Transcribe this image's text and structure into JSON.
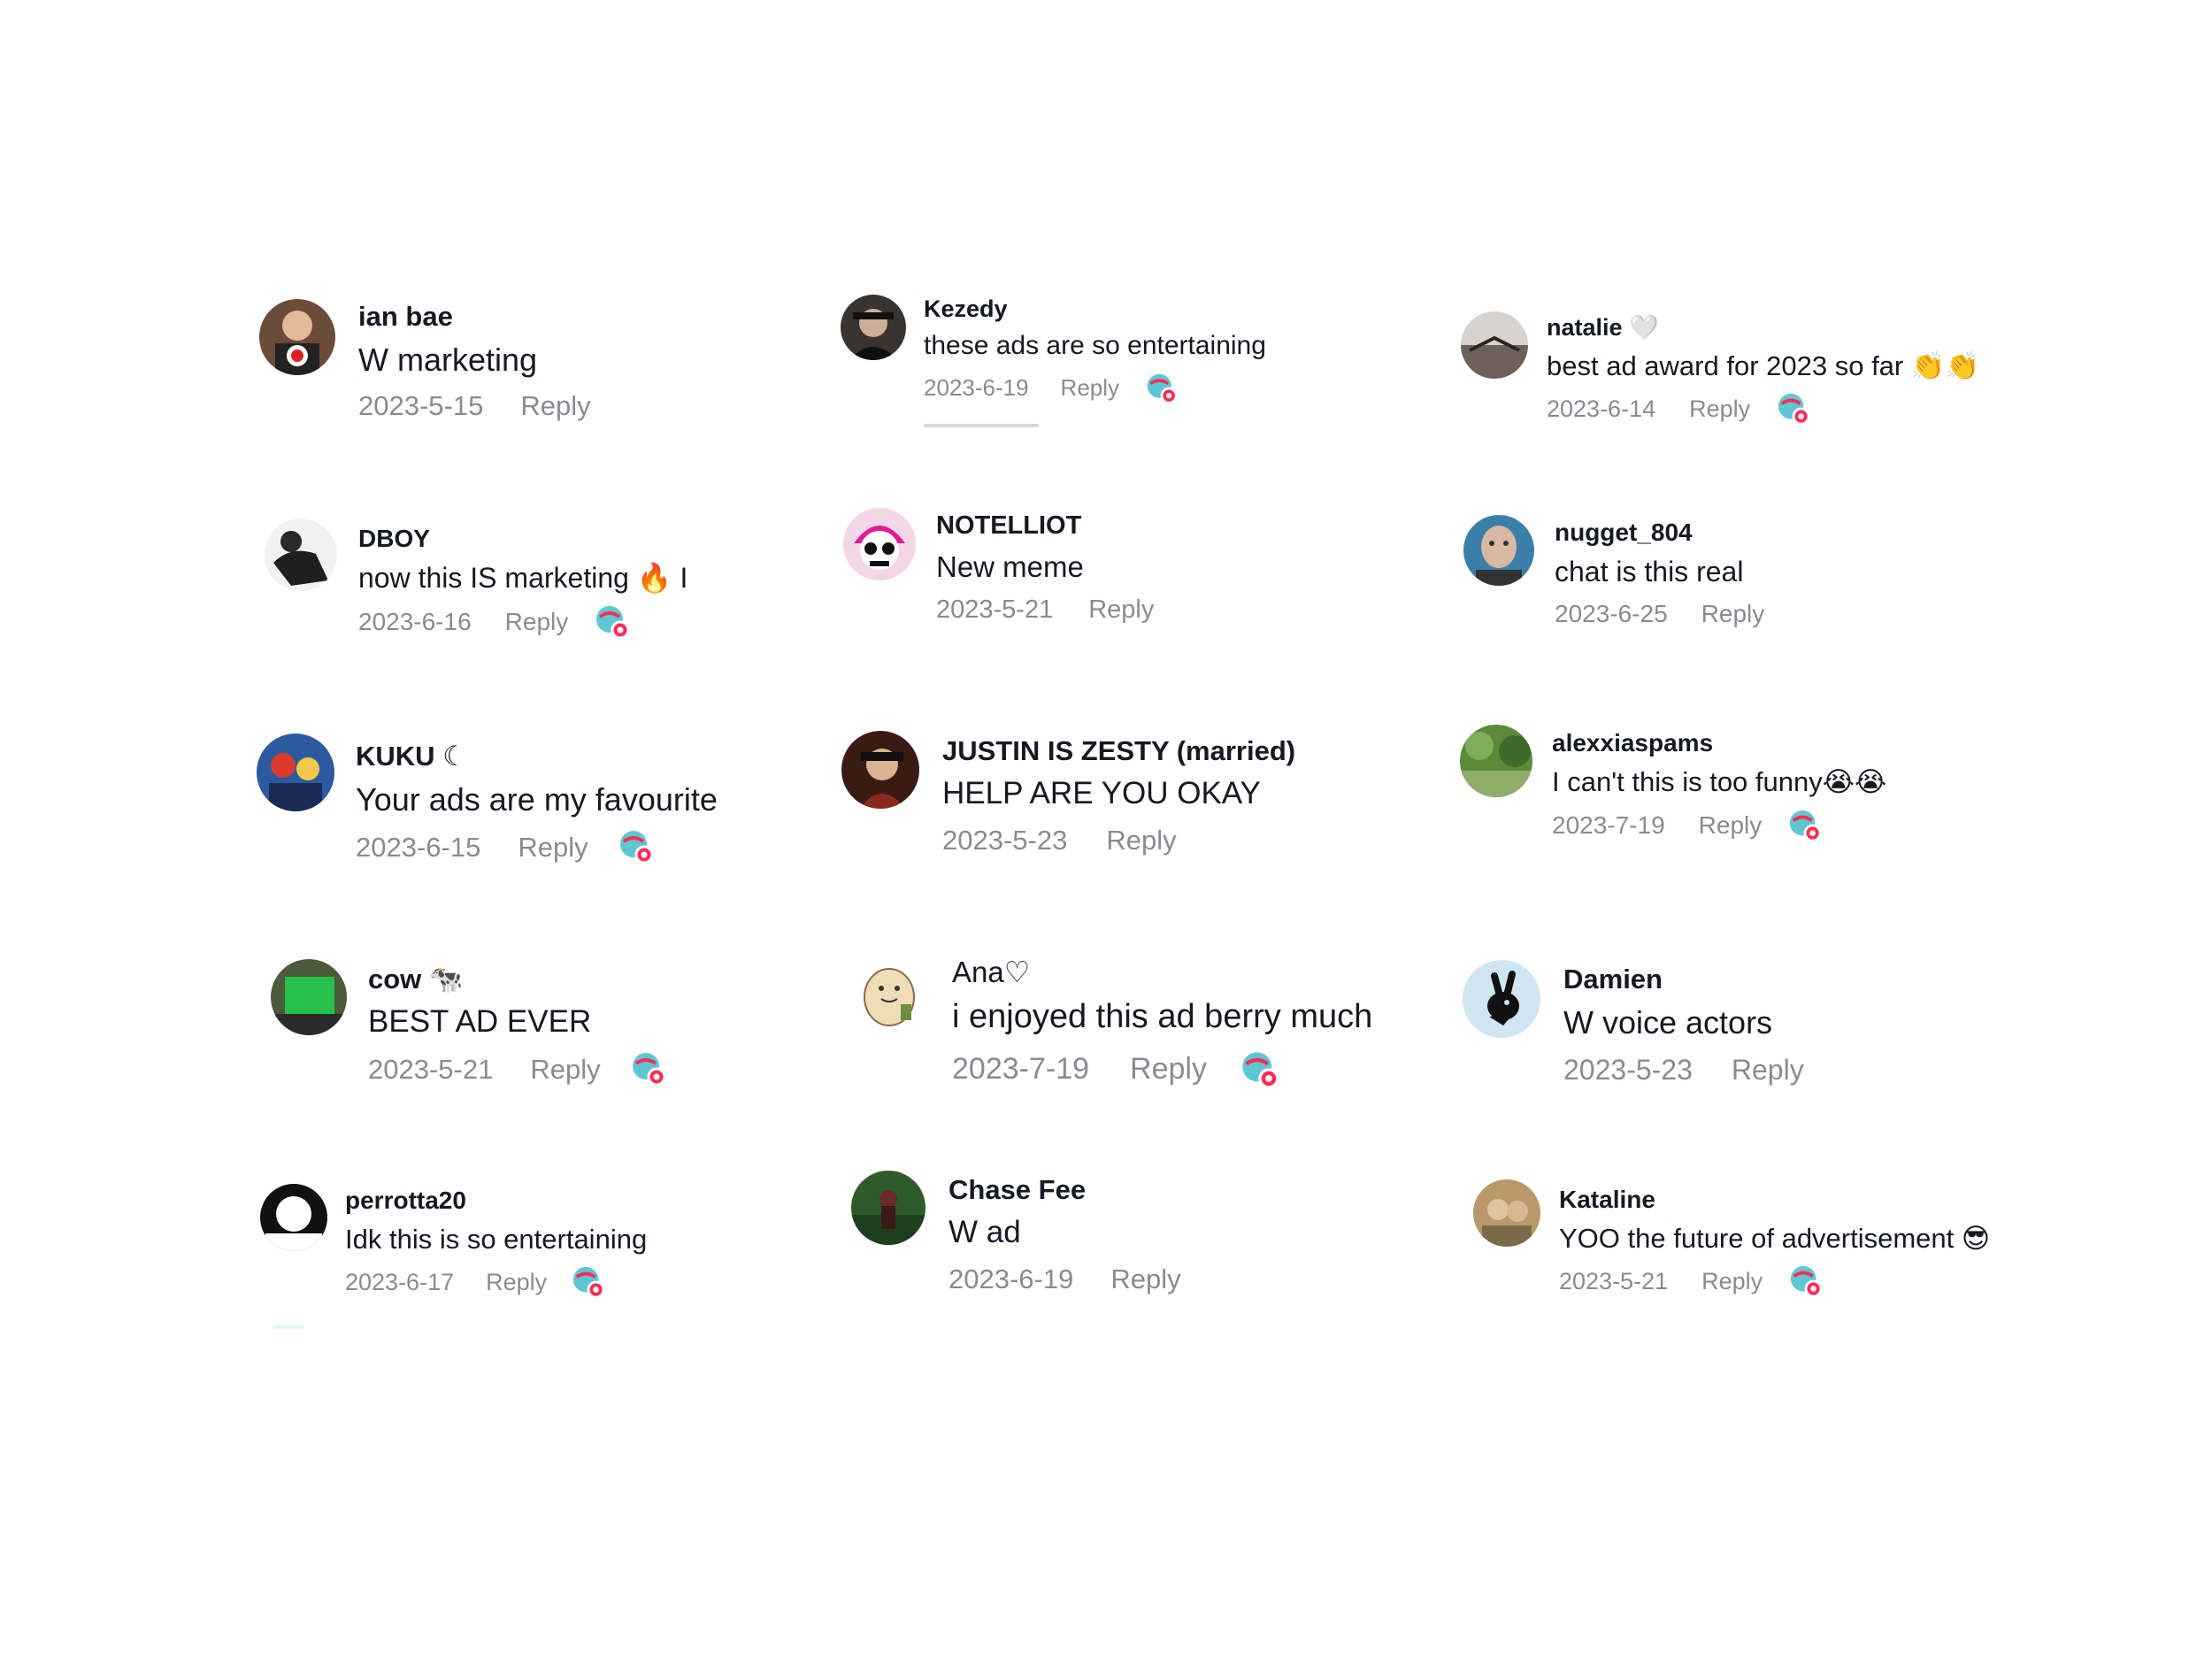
{
  "reply_label": "Reply",
  "colors": {
    "text": "#161823",
    "meta": "#8a8b91",
    "creator_icon_blue": "#5ec7d4",
    "creator_icon_red": "#fe2c55"
  },
  "icons": {
    "creator_liked": "heart-badge-icon"
  },
  "columns": [
    {
      "comments": [
        {
          "username": "ian bae",
          "text": "W marketing",
          "date": "2023-5-15",
          "creator_liked": false
        },
        {
          "username": "DBOY",
          "text": "now this IS marketing 🔥 I",
          "date": "2023-6-16",
          "creator_liked": true
        },
        {
          "username": "KUKU ☾",
          "text": "Your ads are my favourite",
          "date": "2023-6-15",
          "creator_liked": true
        },
        {
          "username": "cow 🐄",
          "text": "BEST AD EVER",
          "date": "2023-5-21",
          "creator_liked": true
        },
        {
          "username": "perrotta20",
          "text": "Idk this is so entertaining",
          "date": "2023-6-17",
          "creator_liked": true
        }
      ]
    },
    {
      "comments": [
        {
          "username": "Kezedy",
          "text": "these ads are so entertaining",
          "date": "2023-6-19",
          "creator_liked": true
        },
        {
          "username": "NOTELLIOT",
          "text": "New meme",
          "date": "2023-5-21",
          "creator_liked": false
        },
        {
          "username": "JUSTIN IS ZESTY (married)",
          "text": "HELP ARE YOU OKAY",
          "date": "2023-5-23",
          "creator_liked": false
        },
        {
          "username": "Ana♡",
          "text": "i enjoyed this ad berry much",
          "date": "2023-7-19",
          "creator_liked": true
        },
        {
          "username": "Chase Fee",
          "text": "W ad",
          "date": "2023-6-19",
          "creator_liked": false
        }
      ]
    },
    {
      "comments": [
        {
          "username": "natalie 🤍",
          "text": "best ad award for 2023 so far 👏👏",
          "date": "2023-6-14",
          "creator_liked": true
        },
        {
          "username": "nugget_804",
          "text": "chat is this real",
          "date": "2023-6-25",
          "creator_liked": false
        },
        {
          "username": "alexxiaspams",
          "text": "I can't this is too funny😭😭",
          "date": "2023-7-19",
          "creator_liked": true
        },
        {
          "username": "Damien",
          "text": "W voice actors",
          "date": "2023-5-23",
          "creator_liked": false
        },
        {
          "username": "Kataline",
          "text": "YOO the future of advertisement 😎",
          "date": "2023-5-21",
          "creator_liked": true
        }
      ]
    }
  ]
}
